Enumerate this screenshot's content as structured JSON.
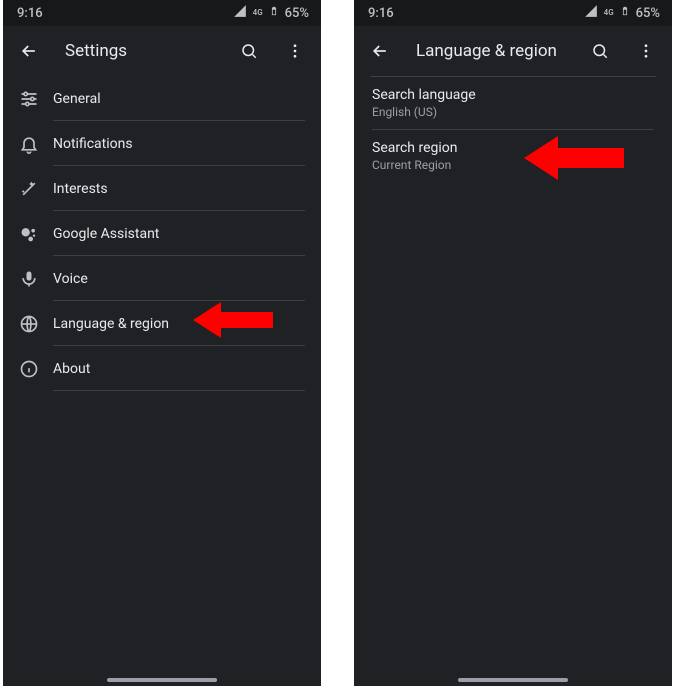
{
  "status": {
    "time": "9:16",
    "network_label": "4G",
    "battery": "65%"
  },
  "left": {
    "title": "Settings",
    "items": [
      {
        "icon": "sliders-icon",
        "label": "General"
      },
      {
        "icon": "bell-icon",
        "label": "Notifications"
      },
      {
        "icon": "wand-icon",
        "label": "Interests"
      },
      {
        "icon": "assistant-icon",
        "label": "Google Assistant"
      },
      {
        "icon": "mic-icon",
        "label": "Voice"
      },
      {
        "icon": "globe-icon",
        "label": "Language & region"
      },
      {
        "icon": "info-icon",
        "label": "About"
      }
    ],
    "highlight_index": 5
  },
  "right": {
    "title": "Language & region",
    "items": [
      {
        "title": "Search language",
        "subtitle": "English (US)"
      },
      {
        "title": "Search region",
        "subtitle": "Current Region"
      }
    ],
    "highlight_index": 1
  },
  "colors": {
    "arrow": "#ff0000"
  }
}
